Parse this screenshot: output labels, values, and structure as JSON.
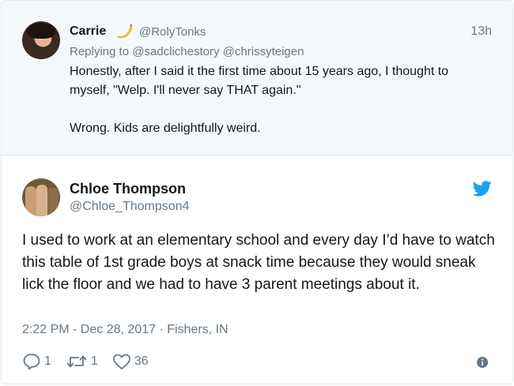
{
  "parent_tweet": {
    "name": "Carrie",
    "handle": "@RolyTonks",
    "time": "13h",
    "replying_prefix": "Replying to",
    "mentions": [
      "@sadclichestory",
      "@chrissyteigen"
    ],
    "text": "Honestly, after I said it the first time about 15 years ago, I thought to myself, \"Welp. I'll never say THAT again.\"\n\nWrong. Kids are delightfully weird."
  },
  "tweet": {
    "name": "Chloe Thompson",
    "handle": "@Chloe_Thompson4",
    "text": "I used to work at an elementary school and every day I’d have to watch this table of 1st grade boys at snack time because they would sneak lick the floor and we had to have 3 parent meetings about it.",
    "timestamp": "2:22 PM - Dec 28, 2017",
    "separator": "·",
    "location": "Fishers, IN",
    "replies": "1",
    "retweets": "1",
    "likes": "36"
  },
  "colors": {
    "twitter_blue": "#1da1f2",
    "secondary_text": "#657786",
    "primary_text": "#14171a",
    "context_bg": "#f5f8fa"
  }
}
